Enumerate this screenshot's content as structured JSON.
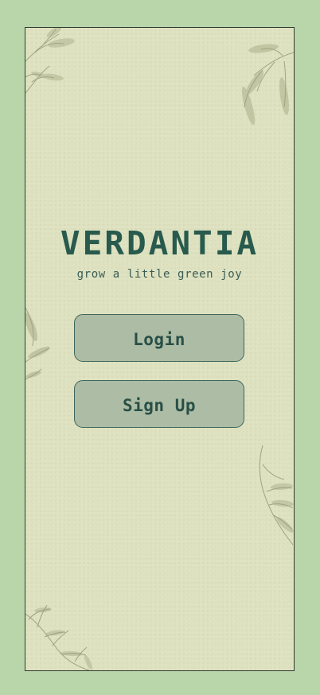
{
  "app": {
    "title": "VERDANTIA",
    "tagline": "grow a little green joy"
  },
  "actions": {
    "login_label": "Login",
    "signup_label": "Sign Up"
  },
  "colors": {
    "page_background": "#b9d5aa",
    "phone_background": "#dfe3c1",
    "brand_text": "#285a4d",
    "button_fill": "#adbca4",
    "button_border": "#3f675d"
  },
  "decorations": {
    "icon_names": [
      "leaf-branch-icon"
    ]
  }
}
